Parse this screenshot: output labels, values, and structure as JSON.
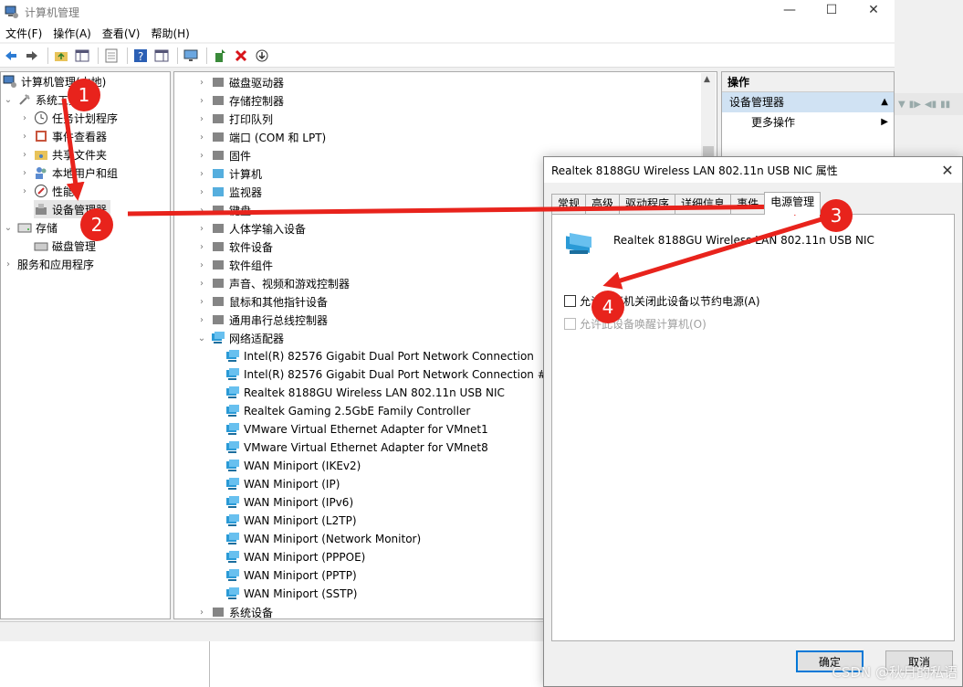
{
  "window": {
    "title": "计算机管理",
    "minimize": "—",
    "maximize": "☐",
    "close": "✕"
  },
  "menu": [
    "文件(F)",
    "操作(A)",
    "查看(V)",
    "帮助(H)"
  ],
  "left_tree": [
    {
      "label": "计算机管理(本地)",
      "icon": "computer-management-icon",
      "chev": ""
    },
    {
      "label": "系统工具",
      "icon": "tools-icon",
      "chev": "⌄"
    },
    {
      "label": "任务计划程序",
      "icon": "clock-icon",
      "chev": "›"
    },
    {
      "label": "事件查看器",
      "icon": "event-viewer-icon",
      "chev": "›"
    },
    {
      "label": "共享文件夹",
      "icon": "shared-folder-icon",
      "chev": "›"
    },
    {
      "label": "本地用户和组",
      "icon": "users-icon",
      "chev": "›"
    },
    {
      "label": "性能",
      "icon": "performance-icon",
      "chev": "›"
    },
    {
      "label": "设备管理器",
      "icon": "device-manager-icon",
      "chev": ""
    },
    {
      "label": "存储",
      "icon": "storage-icon",
      "chev": "⌄"
    },
    {
      "label": "磁盘管理",
      "icon": "disk-icon",
      "chev": ""
    },
    {
      "label": "服务和应用程序",
      "icon": "services-icon",
      "chev": "›"
    }
  ],
  "device_tree": [
    {
      "label": "磁盘驱动器",
      "level": 0,
      "chev": "›",
      "icon": "disk-drive-icon"
    },
    {
      "label": "存储控制器",
      "level": 0,
      "chev": "›",
      "icon": "storage-controller-icon"
    },
    {
      "label": "打印队列",
      "level": 0,
      "chev": "›",
      "icon": "printer-icon"
    },
    {
      "label": "端口 (COM 和 LPT)",
      "level": 0,
      "chev": "›",
      "icon": "port-icon"
    },
    {
      "label": "固件",
      "level": 0,
      "chev": "›",
      "icon": "firmware-icon"
    },
    {
      "label": "计算机",
      "level": 0,
      "chev": "›",
      "icon": "computer-icon"
    },
    {
      "label": "监视器",
      "level": 0,
      "chev": "›",
      "icon": "monitor-icon"
    },
    {
      "label": "键盘",
      "level": 0,
      "chev": "›",
      "icon": "keyboard-icon"
    },
    {
      "label": "人体学输入设备",
      "level": 0,
      "chev": "›",
      "icon": "hid-icon"
    },
    {
      "label": "软件设备",
      "level": 0,
      "chev": "›",
      "icon": "software-device-icon"
    },
    {
      "label": "软件组件",
      "level": 0,
      "chev": "›",
      "icon": "software-component-icon"
    },
    {
      "label": "声音、视频和游戏控制器",
      "level": 0,
      "chev": "›",
      "icon": "sound-icon"
    },
    {
      "label": "鼠标和其他指针设备",
      "level": 0,
      "chev": "›",
      "icon": "mouse-icon"
    },
    {
      "label": "通用串行总线控制器",
      "level": 0,
      "chev": "›",
      "icon": "usb-icon"
    },
    {
      "label": "网络适配器",
      "level": 0,
      "chev": "⌄",
      "icon": "network-adapter-icon"
    },
    {
      "label": "Intel(R) 82576 Gigabit Dual Port Network Connection",
      "level": 1,
      "chev": "",
      "icon": "network-adapter-icon"
    },
    {
      "label": "Intel(R) 82576 Gigabit Dual Port Network Connection #2",
      "level": 1,
      "chev": "",
      "icon": "network-adapter-icon"
    },
    {
      "label": "Realtek 8188GU Wireless LAN 802.11n USB NIC",
      "level": 1,
      "chev": "",
      "icon": "network-adapter-icon"
    },
    {
      "label": "Realtek Gaming 2.5GbE Family Controller",
      "level": 1,
      "chev": "",
      "icon": "network-adapter-icon"
    },
    {
      "label": "VMware Virtual Ethernet Adapter for VMnet1",
      "level": 1,
      "chev": "",
      "icon": "network-adapter-icon"
    },
    {
      "label": "VMware Virtual Ethernet Adapter for VMnet8",
      "level": 1,
      "chev": "",
      "icon": "network-adapter-icon"
    },
    {
      "label": "WAN Miniport (IKEv2)",
      "level": 1,
      "chev": "",
      "icon": "network-adapter-icon"
    },
    {
      "label": "WAN Miniport (IP)",
      "level": 1,
      "chev": "",
      "icon": "network-adapter-icon"
    },
    {
      "label": "WAN Miniport (IPv6)",
      "level": 1,
      "chev": "",
      "icon": "network-adapter-icon"
    },
    {
      "label": "WAN Miniport (L2TP)",
      "level": 1,
      "chev": "",
      "icon": "network-adapter-icon"
    },
    {
      "label": "WAN Miniport (Network Monitor)",
      "level": 1,
      "chev": "",
      "icon": "network-adapter-icon"
    },
    {
      "label": "WAN Miniport (PPPOE)",
      "level": 1,
      "chev": "",
      "icon": "network-adapter-icon"
    },
    {
      "label": "WAN Miniport (PPTP)",
      "level": 1,
      "chev": "",
      "icon": "network-adapter-icon"
    },
    {
      "label": "WAN Miniport (SSTP)",
      "level": 1,
      "chev": "",
      "icon": "network-adapter-icon"
    },
    {
      "label": "系统设备",
      "level": 0,
      "chev": "›",
      "icon": "system-device-icon"
    }
  ],
  "actions": {
    "header": "操作",
    "selected": "设备管理器",
    "more": "更多操作"
  },
  "dialog": {
    "title": "Realtek 8188GU Wireless LAN 802.11n USB NIC 属性",
    "tabs": [
      "常规",
      "高级",
      "驱动程序",
      "详细信息",
      "事件",
      "电源管理"
    ],
    "device_name": "Realtek 8188GU Wireless LAN 802.11n USB NIC",
    "opt_power_off": "允许计算机关闭此设备以节约电源(A)",
    "opt_wake": "允许此设备唤醒计算机(O)",
    "ok": "确定",
    "cancel": "取消"
  },
  "annotations": {
    "step1": "1",
    "step2": "2",
    "step3": "3",
    "step4": "4",
    "color": "#e8231c"
  },
  "watermark": "CSDN @秋月的私语"
}
